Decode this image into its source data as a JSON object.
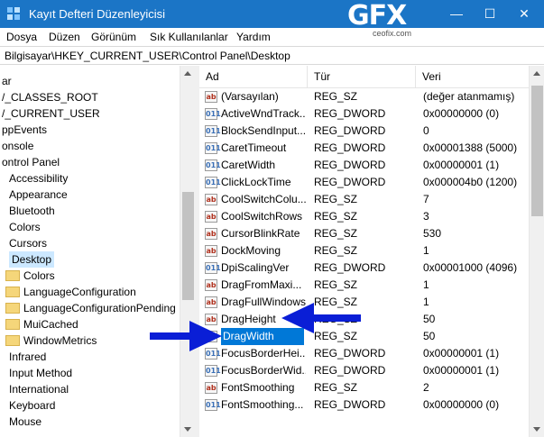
{
  "window": {
    "title": "Kayıt Defteri Düzenleyicisi",
    "logo": "GFX",
    "logo_sub": "ceofix.com",
    "controls": {
      "minimize": "—",
      "maximize": "☐",
      "close": "✕"
    }
  },
  "menu": [
    "Dosya",
    "Düzen",
    "Görünüm",
    "Sık Kullanılanlar",
    "Yardım"
  ],
  "address": "Bilgisayar\\HKEY_CURRENT_USER\\Control Panel\\Desktop",
  "tree": [
    {
      "label": "ar",
      "folder": false
    },
    {
      "label": "/_CLASSES_ROOT",
      "folder": false
    },
    {
      "label": "/_CURRENT_USER",
      "folder": false
    },
    {
      "label": "ppEvents",
      "folder": false
    },
    {
      "label": "onsole",
      "folder": false
    },
    {
      "label": "ontrol Panel",
      "folder": false
    },
    {
      "label": "Accessibility",
      "folder": true
    },
    {
      "label": "Appearance",
      "folder": true
    },
    {
      "label": "Bluetooth",
      "folder": true
    },
    {
      "label": "Colors",
      "folder": true
    },
    {
      "label": "Cursors",
      "folder": true
    },
    {
      "label": "Desktop",
      "folder": true,
      "selected": true
    },
    {
      "label": "Colors",
      "folder": true
    },
    {
      "label": "LanguageConfiguration",
      "folder": true
    },
    {
      "label": "LanguageConfigurationPending",
      "folder": true
    },
    {
      "label": "MuiCached",
      "folder": true
    },
    {
      "label": "WindowMetrics",
      "folder": true
    },
    {
      "label": "Infrared",
      "folder": true
    },
    {
      "label": "Input Method",
      "folder": true
    },
    {
      "label": "International",
      "folder": true
    },
    {
      "label": "Keyboard",
      "folder": true
    },
    {
      "label": "Mouse",
      "folder": true
    }
  ],
  "columns": {
    "name": "Ad",
    "type": "Tür",
    "data": "Veri"
  },
  "values": [
    {
      "name": "(Varsayılan)",
      "type": "REG_SZ",
      "data": "(değer atanmamış)",
      "icon": "ab"
    },
    {
      "name": "ActiveWndTrack...",
      "type": "REG_DWORD",
      "data": "0x00000000 (0)",
      "icon": "bin"
    },
    {
      "name": "BlockSendInput...",
      "type": "REG_DWORD",
      "data": "0",
      "icon": "bin"
    },
    {
      "name": "CaretTimeout",
      "type": "REG_DWORD",
      "data": "0x00001388 (5000)",
      "icon": "bin"
    },
    {
      "name": "CaretWidth",
      "type": "REG_DWORD",
      "data": "0x00000001 (1)",
      "icon": "bin"
    },
    {
      "name": "ClickLockTime",
      "type": "REG_DWORD",
      "data": "0x000004b0 (1200)",
      "icon": "bin"
    },
    {
      "name": "CoolSwitchColu...",
      "type": "REG_SZ",
      "data": "7",
      "icon": "ab"
    },
    {
      "name": "CoolSwitchRows",
      "type": "REG_SZ",
      "data": "3",
      "icon": "ab"
    },
    {
      "name": "CursorBlinkRate",
      "type": "REG_SZ",
      "data": "530",
      "icon": "ab"
    },
    {
      "name": "DockMoving",
      "type": "REG_SZ",
      "data": "1",
      "icon": "ab"
    },
    {
      "name": "DpiScalingVer",
      "type": "REG_DWORD",
      "data": "0x00001000 (4096)",
      "icon": "bin"
    },
    {
      "name": "DragFromMaxi...",
      "type": "REG_SZ",
      "data": "1",
      "icon": "ab"
    },
    {
      "name": "DragFullWindows",
      "type": "REG_SZ",
      "data": "1",
      "icon": "ab"
    },
    {
      "name": "DragHeight",
      "type": "REG_SZ",
      "data": "50",
      "icon": "ab"
    },
    {
      "name": "DragWidth",
      "type": "REG_SZ",
      "data": "50",
      "icon": "ab",
      "selected": true
    },
    {
      "name": "FocusBorderHei...",
      "type": "REG_DWORD",
      "data": "0x00000001 (1)",
      "icon": "bin"
    },
    {
      "name": "FocusBorderWid...",
      "type": "REG_DWORD",
      "data": "0x00000001 (1)",
      "icon": "bin"
    },
    {
      "name": "FontSmoothing",
      "type": "REG_SZ",
      "data": "2",
      "icon": "ab"
    },
    {
      "name": "FontSmoothing...",
      "type": "REG_DWORD",
      "data": "0x00000000 (0)",
      "icon": "bin"
    }
  ],
  "icons": {
    "ab": "ab",
    "bin": "011"
  },
  "colors": {
    "titlebar": "#1b75c6",
    "selection": "#0078d7",
    "arrow": "#0a1ed6"
  }
}
